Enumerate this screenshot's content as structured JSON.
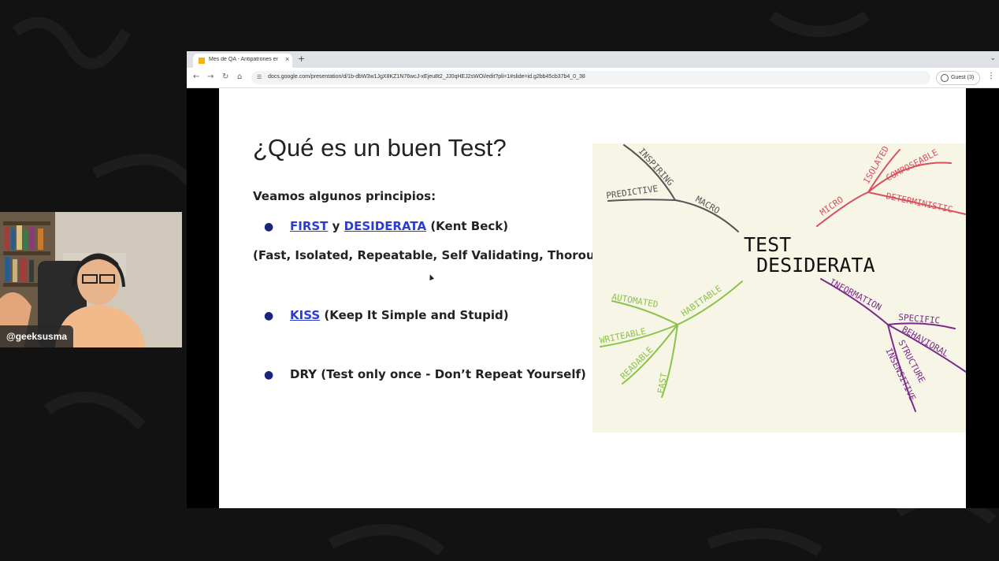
{
  "webcam": {
    "name": "@geeksusma"
  },
  "browser": {
    "tab_title": "Mes de QA - Antipatrones en",
    "tab_close": "×",
    "new_tab": "+",
    "url": "docs.google.com/presentation/d/1b-dbW3w1JgX8KZ1N76wcJ-xEjeu8t2_JJ0qHEJ2sWOI/edit?pli=1#slide=id.g2bb45cb37b4_0_38",
    "guest_label": "Guest (3)"
  },
  "slide": {
    "title": "¿Qué es un buen Test?",
    "subtitle": "Veamos algunos principios:",
    "bullet1": {
      "link1": "FIRST",
      "mid": " y ",
      "link2": "DESIDERATA",
      "rest": " (Kent Beck)"
    },
    "paren": "(Fast, Isolated, Repeatable, Self Validating, Thorough)",
    "bullet2": {
      "link": "KISS",
      "rest": " (Keep It Simple and Stupid)"
    },
    "bullet3": "DRY (Test only once -  Don’t Repeat Yourself)",
    "mindmap": {
      "center_line1": "TEST",
      "center_line2": "DESIDERATA",
      "labels": [
        "INSPIRING",
        "PREDICTIVE",
        "MACRO",
        "ISOLATED",
        "COMPOSEABLE",
        "MICRO",
        "DETERMINISTIC",
        "AUTOMATED",
        "HABITABLE",
        "WRITEABLE",
        "READABLE",
        "FAST",
        "INFORMATION",
        "SPECIFIC",
        "BEHAVIORAL",
        "STRUCTURE",
        "INSENSITIVE"
      ],
      "colors": {
        "grey": "#555555",
        "red": "#d94f5c",
        "green": "#8bc34a",
        "purple": "#7b2a8c"
      }
    }
  }
}
